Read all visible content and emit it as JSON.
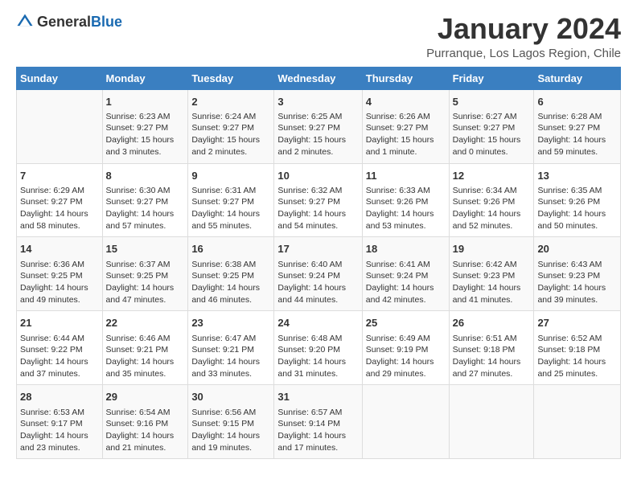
{
  "header": {
    "logo_general": "General",
    "logo_blue": "Blue",
    "month_title": "January 2024",
    "subtitle": "Purranque, Los Lagos Region, Chile"
  },
  "days_of_week": [
    "Sunday",
    "Monday",
    "Tuesday",
    "Wednesday",
    "Thursday",
    "Friday",
    "Saturday"
  ],
  "weeks": [
    [
      {
        "day": "",
        "info": ""
      },
      {
        "day": "1",
        "info": "Sunrise: 6:23 AM\nSunset: 9:27 PM\nDaylight: 15 hours\nand 3 minutes."
      },
      {
        "day": "2",
        "info": "Sunrise: 6:24 AM\nSunset: 9:27 PM\nDaylight: 15 hours\nand 2 minutes."
      },
      {
        "day": "3",
        "info": "Sunrise: 6:25 AM\nSunset: 9:27 PM\nDaylight: 15 hours\nand 2 minutes."
      },
      {
        "day": "4",
        "info": "Sunrise: 6:26 AM\nSunset: 9:27 PM\nDaylight: 15 hours\nand 1 minute."
      },
      {
        "day": "5",
        "info": "Sunrise: 6:27 AM\nSunset: 9:27 PM\nDaylight: 15 hours\nand 0 minutes."
      },
      {
        "day": "6",
        "info": "Sunrise: 6:28 AM\nSunset: 9:27 PM\nDaylight: 14 hours\nand 59 minutes."
      }
    ],
    [
      {
        "day": "7",
        "info": "Sunrise: 6:29 AM\nSunset: 9:27 PM\nDaylight: 14 hours\nand 58 minutes."
      },
      {
        "day": "8",
        "info": "Sunrise: 6:30 AM\nSunset: 9:27 PM\nDaylight: 14 hours\nand 57 minutes."
      },
      {
        "day": "9",
        "info": "Sunrise: 6:31 AM\nSunset: 9:27 PM\nDaylight: 14 hours\nand 55 minutes."
      },
      {
        "day": "10",
        "info": "Sunrise: 6:32 AM\nSunset: 9:27 PM\nDaylight: 14 hours\nand 54 minutes."
      },
      {
        "day": "11",
        "info": "Sunrise: 6:33 AM\nSunset: 9:26 PM\nDaylight: 14 hours\nand 53 minutes."
      },
      {
        "day": "12",
        "info": "Sunrise: 6:34 AM\nSunset: 9:26 PM\nDaylight: 14 hours\nand 52 minutes."
      },
      {
        "day": "13",
        "info": "Sunrise: 6:35 AM\nSunset: 9:26 PM\nDaylight: 14 hours\nand 50 minutes."
      }
    ],
    [
      {
        "day": "14",
        "info": "Sunrise: 6:36 AM\nSunset: 9:25 PM\nDaylight: 14 hours\nand 49 minutes."
      },
      {
        "day": "15",
        "info": "Sunrise: 6:37 AM\nSunset: 9:25 PM\nDaylight: 14 hours\nand 47 minutes."
      },
      {
        "day": "16",
        "info": "Sunrise: 6:38 AM\nSunset: 9:25 PM\nDaylight: 14 hours\nand 46 minutes."
      },
      {
        "day": "17",
        "info": "Sunrise: 6:40 AM\nSunset: 9:24 PM\nDaylight: 14 hours\nand 44 minutes."
      },
      {
        "day": "18",
        "info": "Sunrise: 6:41 AM\nSunset: 9:24 PM\nDaylight: 14 hours\nand 42 minutes."
      },
      {
        "day": "19",
        "info": "Sunrise: 6:42 AM\nSunset: 9:23 PM\nDaylight: 14 hours\nand 41 minutes."
      },
      {
        "day": "20",
        "info": "Sunrise: 6:43 AM\nSunset: 9:23 PM\nDaylight: 14 hours\nand 39 minutes."
      }
    ],
    [
      {
        "day": "21",
        "info": "Sunrise: 6:44 AM\nSunset: 9:22 PM\nDaylight: 14 hours\nand 37 minutes."
      },
      {
        "day": "22",
        "info": "Sunrise: 6:46 AM\nSunset: 9:21 PM\nDaylight: 14 hours\nand 35 minutes."
      },
      {
        "day": "23",
        "info": "Sunrise: 6:47 AM\nSunset: 9:21 PM\nDaylight: 14 hours\nand 33 minutes."
      },
      {
        "day": "24",
        "info": "Sunrise: 6:48 AM\nSunset: 9:20 PM\nDaylight: 14 hours\nand 31 minutes."
      },
      {
        "day": "25",
        "info": "Sunrise: 6:49 AM\nSunset: 9:19 PM\nDaylight: 14 hours\nand 29 minutes."
      },
      {
        "day": "26",
        "info": "Sunrise: 6:51 AM\nSunset: 9:18 PM\nDaylight: 14 hours\nand 27 minutes."
      },
      {
        "day": "27",
        "info": "Sunrise: 6:52 AM\nSunset: 9:18 PM\nDaylight: 14 hours\nand 25 minutes."
      }
    ],
    [
      {
        "day": "28",
        "info": "Sunrise: 6:53 AM\nSunset: 9:17 PM\nDaylight: 14 hours\nand 23 minutes."
      },
      {
        "day": "29",
        "info": "Sunrise: 6:54 AM\nSunset: 9:16 PM\nDaylight: 14 hours\nand 21 minutes."
      },
      {
        "day": "30",
        "info": "Sunrise: 6:56 AM\nSunset: 9:15 PM\nDaylight: 14 hours\nand 19 minutes."
      },
      {
        "day": "31",
        "info": "Sunrise: 6:57 AM\nSunset: 9:14 PM\nDaylight: 14 hours\nand 17 minutes."
      },
      {
        "day": "",
        "info": ""
      },
      {
        "day": "",
        "info": ""
      },
      {
        "day": "",
        "info": ""
      }
    ]
  ]
}
